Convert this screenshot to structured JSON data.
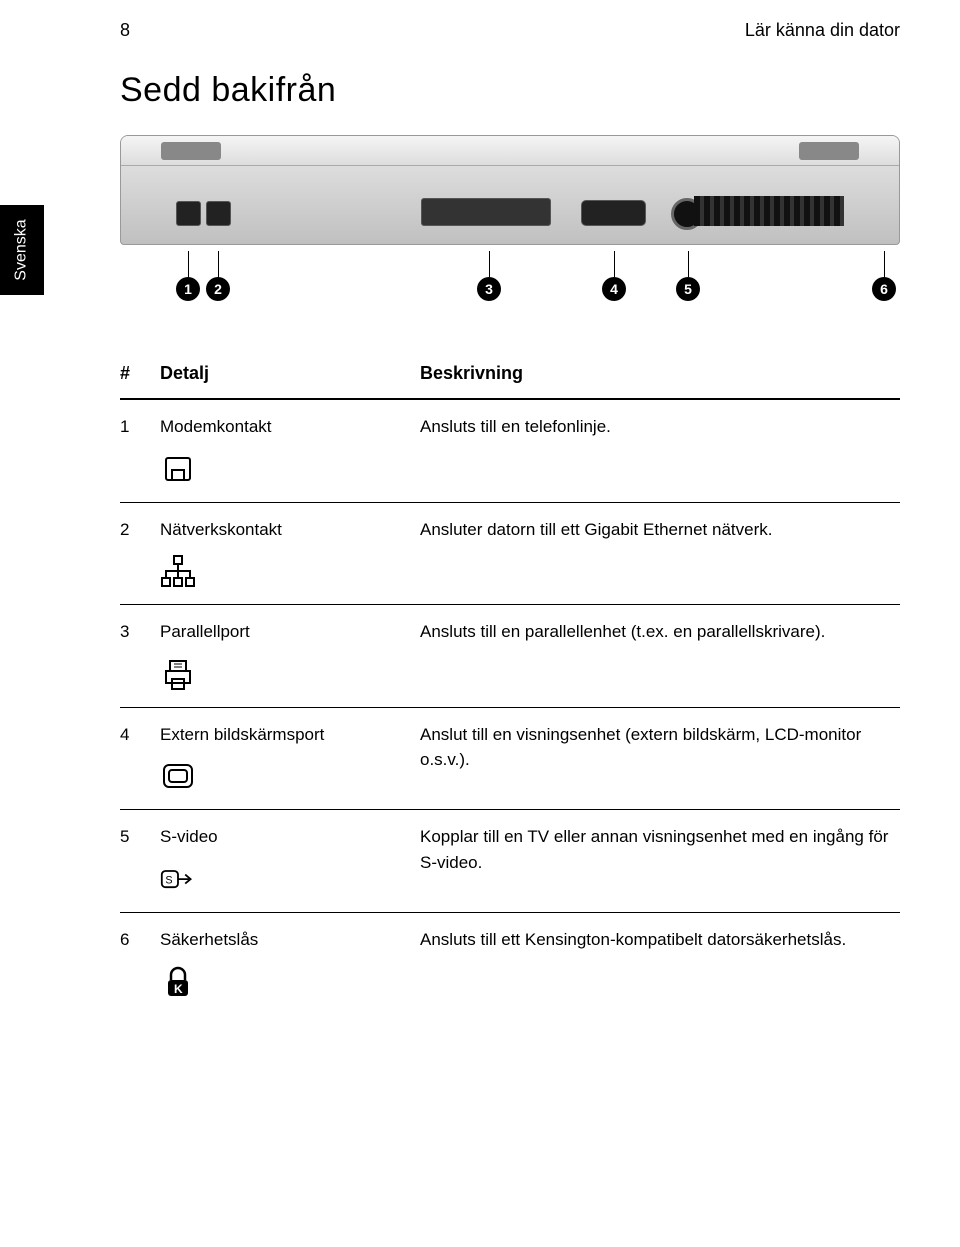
{
  "page_number": "8",
  "chapter_title": "Lär känna din dator",
  "section_title": "Sedd bakifrån",
  "side_tab": "Svenska",
  "callouts": [
    "1",
    "2",
    "3",
    "4",
    "5",
    "6"
  ],
  "table": {
    "headers": {
      "num": "#",
      "detail": "Detalj",
      "desc": "Beskrivning"
    },
    "rows": [
      {
        "num": "1",
        "detail": "Modemkontakt",
        "desc": "Ansluts till en telefonlinje.",
        "icon": "modem"
      },
      {
        "num": "2",
        "detail": "Nätverkskontakt",
        "desc": "Ansluter datorn till ett Gigabit Ethernet nätverk.",
        "icon": "network"
      },
      {
        "num": "3",
        "detail": "Parallellport",
        "desc": "Ansluts till en parallellenhet (t.ex. en parallellskrivare).",
        "icon": "parallel"
      },
      {
        "num": "4",
        "detail": "Extern bildskärmsport",
        "desc": "Anslut till en visningsenhet (extern bildskärm, LCD-monitor o.s.v.).",
        "icon": "monitor"
      },
      {
        "num": "5",
        "detail": "S-video",
        "desc": "Kopplar till en TV eller annan visningsenhet med en ingång för S-video.",
        "icon": "svideo"
      },
      {
        "num": "6",
        "detail": "Säkerhetslås",
        "desc": "Ansluts till ett Kensington-kompatibelt datorsäkerhetslås.",
        "icon": "lock"
      }
    ]
  }
}
